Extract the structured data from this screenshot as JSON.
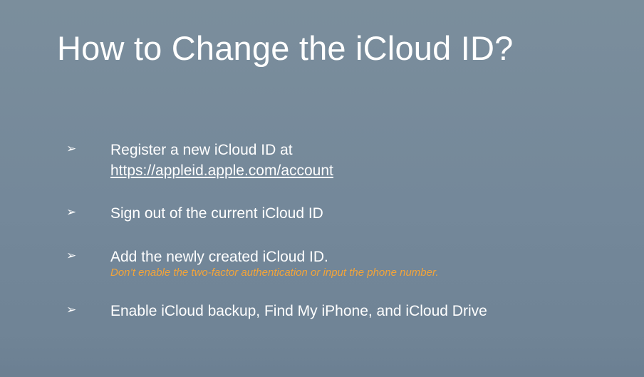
{
  "slide": {
    "title": "How to Change the iCloud ID?",
    "bullet_marker": "➢",
    "bullets": [
      {
        "text": "Register a new iCloud ID at",
        "link": "https://appleid.apple.com/account"
      },
      {
        "text": "Sign out of the current iCloud ID"
      },
      {
        "text": "Add the newly created iCloud ID.",
        "note": "Don’t enable the two-factor authentication or input the phone number."
      },
      {
        "text": "Enable iCloud backup, Find My iPhone, and iCloud Drive"
      }
    ]
  },
  "colors": {
    "background": "#7a8c9a",
    "text": "#ffffff",
    "note": "#f2a43a"
  }
}
